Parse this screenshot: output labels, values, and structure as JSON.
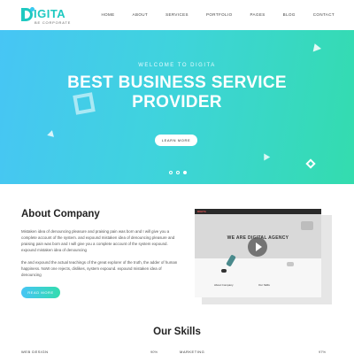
{
  "header": {
    "logo_text": "IGITA",
    "logo_tagline": "BE CORPORATE",
    "nav": [
      "HOME",
      "ABOUT",
      "SERVICES",
      "PORTFOLIO",
      "PAGES",
      "BLOG",
      "CONTACT"
    ]
  },
  "hero": {
    "subtitle": "WELCOME TO DIGITA",
    "title_line1": "BEST BUSINESS SERVICE",
    "title_line2": "PROVIDER",
    "button": "LEARN MORE",
    "slides": 3,
    "active_slide": 3
  },
  "about": {
    "title": "About Company",
    "paragraph1": "Mistaken idea of denouncing pleasure and praising pain was born and I will give you a complete account of the system. and expound mistaken idea of denouncing pleasure and praising pain was born and I will give you a complete account of the system expound. expound mistaken idea of denouncing",
    "paragraph2": "the and expound the actual teachings of the great explorer of the truth, the adder of human happiness. NoW one rejects, dislikes, system expound. expound mistaken idea of denouncing",
    "button": "READ MORE"
  },
  "video": {
    "brand": "DIGITA",
    "headline": "WE ARE DIGITAL AGENCY",
    "col1": "About Company",
    "col2": "Our Skills"
  },
  "skills": {
    "title": "Our Skills",
    "items": [
      {
        "label": "WEB DESIGN",
        "value": "90%"
      },
      {
        "label": "MARKETING",
        "value": "97%"
      }
    ]
  },
  "colors": {
    "accent": "#1fc9c1",
    "gradient_start": "#47c5f5",
    "gradient_end": "#33dcae"
  }
}
